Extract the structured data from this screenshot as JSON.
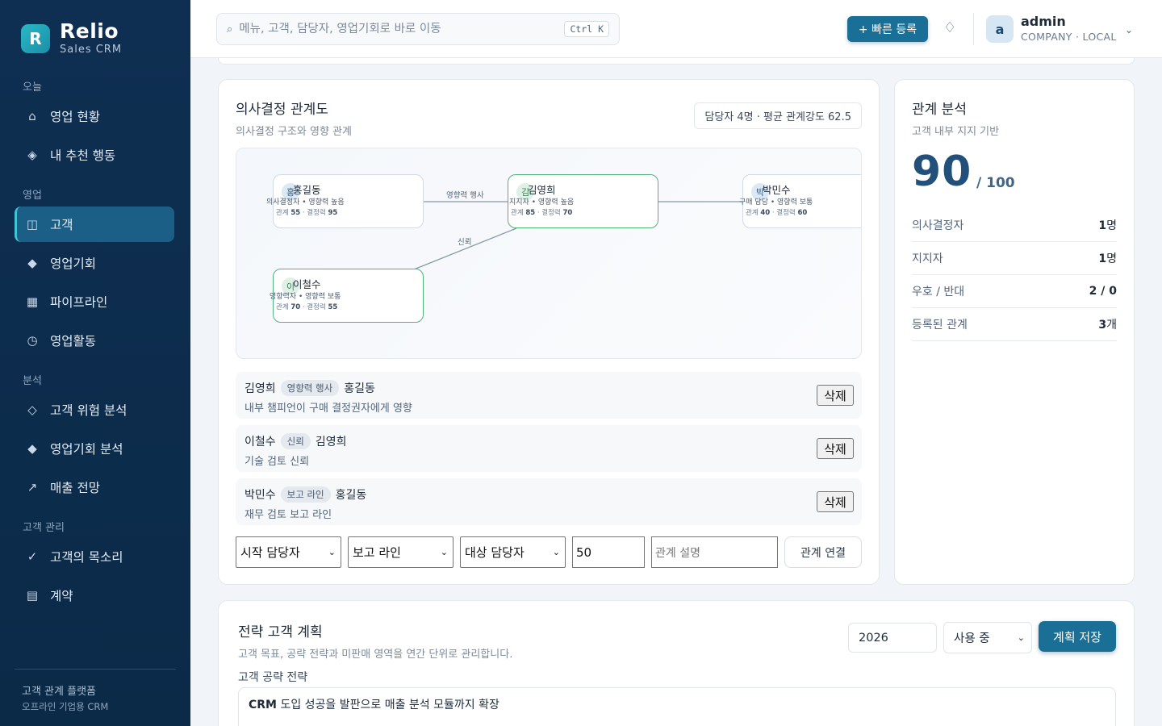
{
  "brand": {
    "logo_letter": "R",
    "name": "Relio",
    "sub": "Sales CRM"
  },
  "nav": {
    "sections": [
      "오늘",
      "영업",
      "분석",
      "고객 관리"
    ],
    "items": [
      {
        "icon": "⌂",
        "label": "영업 현황"
      },
      {
        "icon": "◈",
        "label": "내 추천 행동"
      },
      {
        "icon": "◫",
        "label": "고객"
      },
      {
        "icon": "◆",
        "label": "영업기회"
      },
      {
        "icon": "▦",
        "label": "파이프라인"
      },
      {
        "icon": "◷",
        "label": "영업활동"
      },
      {
        "icon": "◇",
        "label": "고객 위험 분석"
      },
      {
        "icon": "◆",
        "label": "영업기회 분석"
      },
      {
        "icon": "↗",
        "label": "매출 전망"
      },
      {
        "icon": "✓",
        "label": "고객의 목소리"
      },
      {
        "icon": "▤",
        "label": "계약"
      }
    ],
    "footer_1": "고객 관계 플랫폼",
    "footer_2": "오프라인 기업용 CRM"
  },
  "header": {
    "search_placeholder": "메뉴, 고객, 담당자, 영업기회로 바로 이동",
    "search_kbd": "Ctrl K",
    "quick_add": "+ 빠른 등록",
    "user_initial": "a",
    "user_name": "admin",
    "user_role": "COMPANY · LOCAL"
  },
  "map_panel": {
    "title": "의사결정 관계도",
    "subtitle": "의사결정 구조와 영향 관계",
    "summary": "담당자 4명 · 평균 관계강도 62.5",
    "nodes": [
      {
        "initial": "홍",
        "name": "홍길동",
        "role": "의사결정자 • 영향력 높음",
        "rel": "55",
        "dec": "95"
      },
      {
        "initial": "김",
        "name": "김영희",
        "role": "지지자 • 영향력 높음",
        "rel": "85",
        "dec": "70"
      },
      {
        "initial": "박",
        "name": "박민수",
        "role": "구매 담당 • 영향력 보통",
        "rel": "40",
        "dec": "60"
      },
      {
        "initial": "이",
        "name": "이철수",
        "role": "영향력자 • 영향력 보통",
        "rel": "70",
        "dec": "55"
      }
    ],
    "metric_rel_label": "관계",
    "metric_dec_label": "결정력",
    "edge_labels": [
      "영향력 행사",
      "신뢰"
    ],
    "relations": [
      {
        "from": "김영희",
        "type": "영향력 행사",
        "to": "홍길동",
        "desc": "내부 챔피언이 구매 결정권자에게 영향"
      },
      {
        "from": "이철수",
        "type": "신뢰",
        "to": "김영희",
        "desc": "기술 검토 신뢰"
      },
      {
        "from": "박민수",
        "type": "보고 라인",
        "to": "홍길동",
        "desc": "재무 검토 보고 라인"
      }
    ],
    "delete_label": "삭제",
    "form": {
      "from_select": "시작 담당자",
      "type_select": "보고 라인",
      "to_select": "대상 담당자",
      "strength": "50",
      "desc_placeholder": "관계 설명",
      "connect_label": "관계 연결"
    }
  },
  "analysis": {
    "title": "관계 분석",
    "subtitle": "고객 내부 지지 기반",
    "score": "90",
    "score_max": "/ 100",
    "rows": [
      {
        "label": "의사결정자",
        "value": "1",
        "unit": "명"
      },
      {
        "label": "지지자",
        "value": "1",
        "unit": "명"
      },
      {
        "label": "우호 / 반대",
        "value": "2 / 0",
        "unit": ""
      },
      {
        "label": "등록된 관계",
        "value": "3",
        "unit": "개"
      }
    ]
  },
  "plan": {
    "title": "전략 고객 계획",
    "subtitle": "고객 목표, 공략 전략과 미판매 영역을 연간 단위로 관리합니다.",
    "year": "2026",
    "status": "사용 중",
    "save_label": "계획 저장",
    "strategy_label": "고객 공략 전략",
    "strategy_bold": "CRM",
    "strategy_rest": " 도입 성공을 발판으로 매출 분석 모듈까지 확장"
  },
  "colors": {
    "sidebar": "#0f2f52",
    "accent": "#1a6f96",
    "node_green": "#52b27c"
  }
}
